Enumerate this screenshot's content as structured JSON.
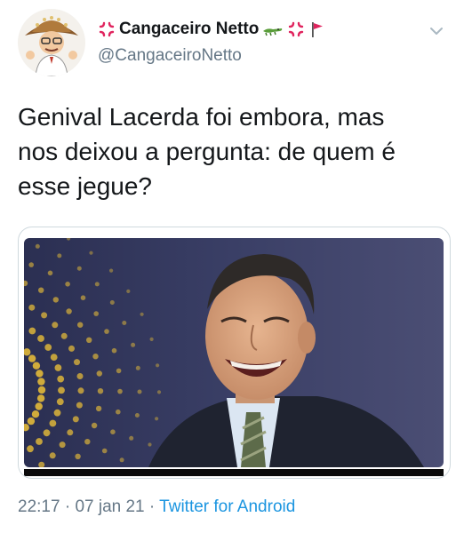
{
  "author": {
    "display_name": "Cangaceiro Netto",
    "handle": "@CangaceiroNetto",
    "name_icons": [
      "anger-symbol-icon",
      "crocodile-icon",
      "anger-symbol-icon",
      "red-flag-icon"
    ]
  },
  "tweet": {
    "text": "Genival Lacerda foi embora, mas\nnos deixou a pergunta: de quem é\nesse jegue?",
    "time": "22:17",
    "separator": "·",
    "date": "07 jan 21",
    "source": "Twitter for Android"
  },
  "colors": {
    "text": "#14171a",
    "secondary": "#657786",
    "link": "#1b95e0"
  }
}
